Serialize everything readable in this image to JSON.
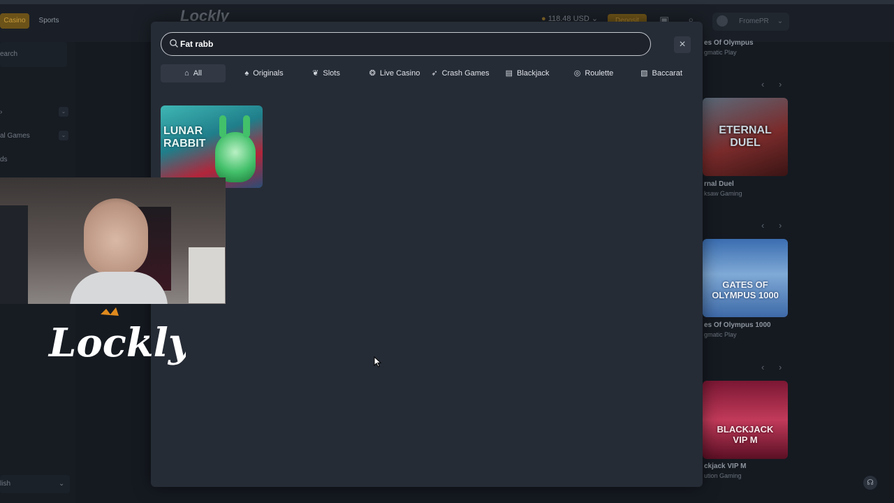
{
  "header": {
    "tabs": [
      "Casino",
      "Sports"
    ],
    "logo": "Lockly",
    "balance": "118.48 USD",
    "deposit_label": "Deposit",
    "username": "FromePR"
  },
  "sidebar": {
    "search_label": "earch",
    "items": [
      "al Games",
      "ds"
    ],
    "language": "lish"
  },
  "search_modal": {
    "query": "Fat rabb",
    "close_label": "×",
    "categories": [
      {
        "label": "All",
        "icon": "home-icon"
      },
      {
        "label": "Originals",
        "icon": "spade-icon"
      },
      {
        "label": "Slots",
        "icon": "cherry-icon"
      },
      {
        "label": "Live Casino",
        "icon": "chip-icon"
      },
      {
        "label": "Crash Games",
        "icon": "rocket-icon"
      },
      {
        "label": "Blackjack",
        "icon": "card-icon"
      },
      {
        "label": "Roulette",
        "icon": "roulette-icon"
      },
      {
        "label": "Baccarat",
        "icon": "cards-icon"
      }
    ],
    "results": [
      {
        "title_art": "LUNAR RABBIT"
      }
    ]
  },
  "background_games": [
    {
      "title": "es Of Olympus",
      "provider": "gmatic Play"
    },
    {
      "title": "rnal Duel",
      "provider": "ksaw Gaming",
      "art": "ETERNAL DUEL"
    },
    {
      "title": "es Of Olympus 1000",
      "provider": "gmatic Play",
      "art": "GATES OF OLYMPUS 1000"
    },
    {
      "title": "ckjack VIP M",
      "provider": "ution Gaming",
      "art": "BLACKJACK VIP M"
    }
  ],
  "streamer_logo": "Lockly",
  "colors": {
    "accent": "#c79a3c",
    "modal_bg": "#262c36",
    "page_bg": "#151a21"
  }
}
